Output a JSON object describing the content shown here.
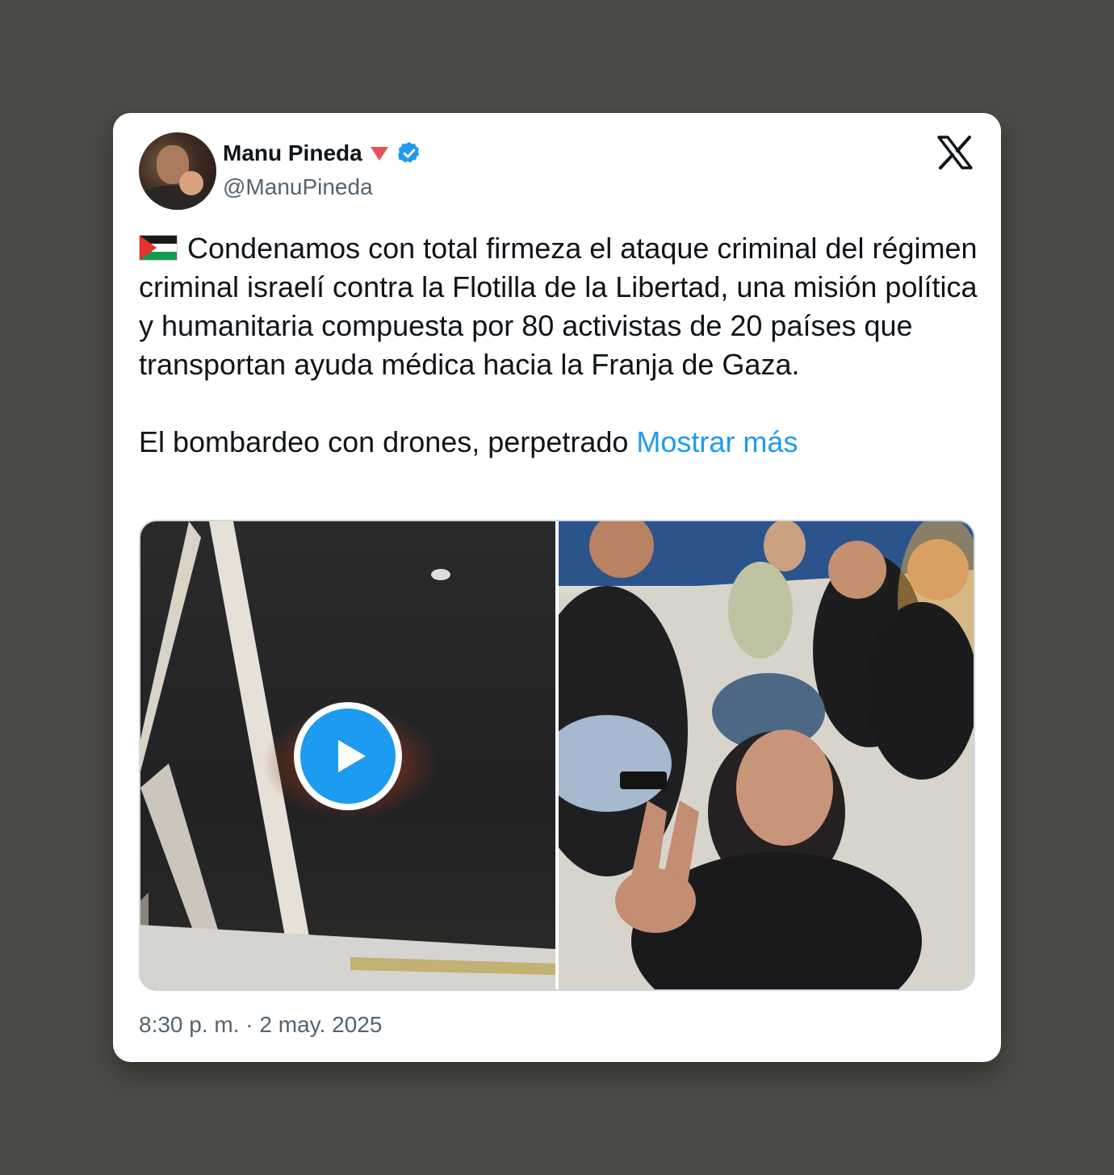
{
  "author": {
    "name": "Manu Pineda",
    "handle": "@ManuPineda"
  },
  "tweet": {
    "paragraph1": "Condenamos con total firmeza el ataque criminal del régimen criminal israelí contra la Flotilla de la Libertad, una misión política y humanitaria compuesta por 80 activistas de 20 países que transportan ayuda médica hacia la Franja de Gaza.",
    "paragraph2": "El bombardeo con drones, perpetrado",
    "show_more_label": "Mostrar más"
  },
  "timestamp": "8:30 p. m. · 2 may. 2025",
  "icons": {
    "logo": "x-logo-icon",
    "verified": "verified-badge-icon",
    "triangle": "red-triangle-icon",
    "flag": "palestine-flag-icon",
    "play": "play-icon"
  },
  "colors": {
    "link": "#1d9bf0",
    "verified": "#1d9bf0",
    "text": "#0f1419",
    "secondary": "#536471",
    "background": "#4c4a44"
  }
}
